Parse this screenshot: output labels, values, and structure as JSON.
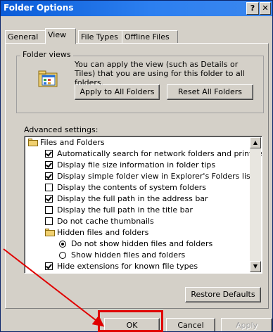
{
  "window": {
    "title": "Folder Options",
    "help_button": "?",
    "close_button": "✕"
  },
  "tabs": [
    {
      "label": "General",
      "active": false
    },
    {
      "label": "View",
      "active": true
    },
    {
      "label": "File Types",
      "active": false
    },
    {
      "label": "Offline Files",
      "active": false
    }
  ],
  "folder_views": {
    "legend": "Folder views",
    "description": "You can apply the view (such as Details or Tiles) that you are using for this folder to all folders.",
    "apply_all_label": "Apply to All Folders",
    "reset_all_label": "Reset All Folders",
    "icon": "folder-views-icon"
  },
  "advanced": {
    "label": "Advanced settings:",
    "items": [
      {
        "type": "folder",
        "label": "Files and Folders",
        "indent": 0
      },
      {
        "type": "checkbox",
        "label": "Automatically search for network folders and printers",
        "checked": true,
        "indent": 1
      },
      {
        "type": "checkbox",
        "label": "Display file size information in folder tips",
        "checked": true,
        "indent": 1
      },
      {
        "type": "checkbox",
        "label": "Display simple folder view in Explorer's Folders list",
        "checked": true,
        "indent": 1
      },
      {
        "type": "checkbox",
        "label": "Display the contents of system folders",
        "checked": false,
        "indent": 1
      },
      {
        "type": "checkbox",
        "label": "Display the full path in the address bar",
        "checked": true,
        "indent": 1
      },
      {
        "type": "checkbox",
        "label": "Display the full path in the title bar",
        "checked": false,
        "indent": 1
      },
      {
        "type": "checkbox",
        "label": "Do not cache thumbnails",
        "checked": false,
        "indent": 1
      },
      {
        "type": "folder",
        "label": "Hidden files and folders",
        "indent": 1
      },
      {
        "type": "radio",
        "label": "Do not show hidden files and folders",
        "selected": true,
        "indent": 2
      },
      {
        "type": "radio",
        "label": "Show hidden files and folders",
        "selected": false,
        "indent": 2
      },
      {
        "type": "checkbox",
        "label": "Hide extensions for known file types",
        "checked": true,
        "indent": 1
      }
    ]
  },
  "restore_defaults_label": "Restore Defaults",
  "buttons": {
    "ok": "OK",
    "cancel": "Cancel",
    "apply": "Apply"
  },
  "colors": {
    "title_bar": "#0a5cd8",
    "dialog_face": "#d4d0c8",
    "highlight_annotation": "#e00000"
  }
}
